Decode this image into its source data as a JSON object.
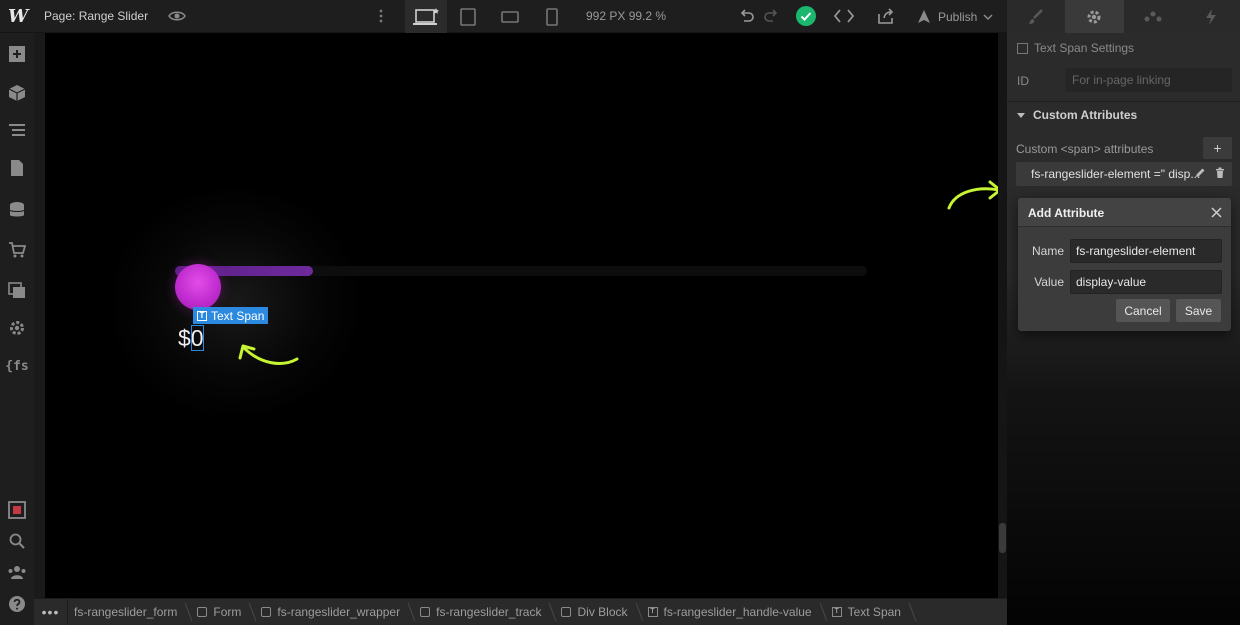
{
  "topbar": {
    "logo": "W",
    "page_label": "Page: Range Slider",
    "width_readout": "992 PX  99.2 %",
    "publish_label": "Publish"
  },
  "sidebar": {
    "fs_label": "{fs"
  },
  "canvas": {
    "value_prefix": "$",
    "value_digit": "0",
    "span_tag": "Text Span",
    "slider_fill_fraction": 0.2
  },
  "breadcrumb": {
    "more": "•••",
    "items": [
      {
        "label": "fs-rangeslider_form",
        "icon": "none"
      },
      {
        "label": "Form",
        "icon": "box"
      },
      {
        "label": "fs-rangeslider_wrapper",
        "icon": "box"
      },
      {
        "label": "fs-rangeslider_track",
        "icon": "box"
      },
      {
        "label": "Div Block",
        "icon": "box"
      },
      {
        "label": "fs-rangeslider_handle-value",
        "icon": "text"
      },
      {
        "label": "Text Span",
        "icon": "text"
      }
    ]
  },
  "settings": {
    "title": "Text Span Settings",
    "id_label": "ID",
    "id_placeholder": "For in-page linking",
    "section_title": "Custom Attributes",
    "custom_label": "Custom <span> attributes",
    "add_label": "+",
    "attribute_row": "fs-rangeslider-element =\" disp..."
  },
  "dialog": {
    "title": "Add Attribute",
    "name_label": "Name",
    "name_value": "fs-rangeslider-element",
    "value_label": "Value",
    "value_value": "display-value",
    "cancel_label": "Cancel",
    "save_label": "Save"
  },
  "colors": {
    "accent_blue": "#2b89e0",
    "arrow_green": "#c6f432",
    "handle_magenta": "#d238dc",
    "status_green": "#1bb76e"
  }
}
